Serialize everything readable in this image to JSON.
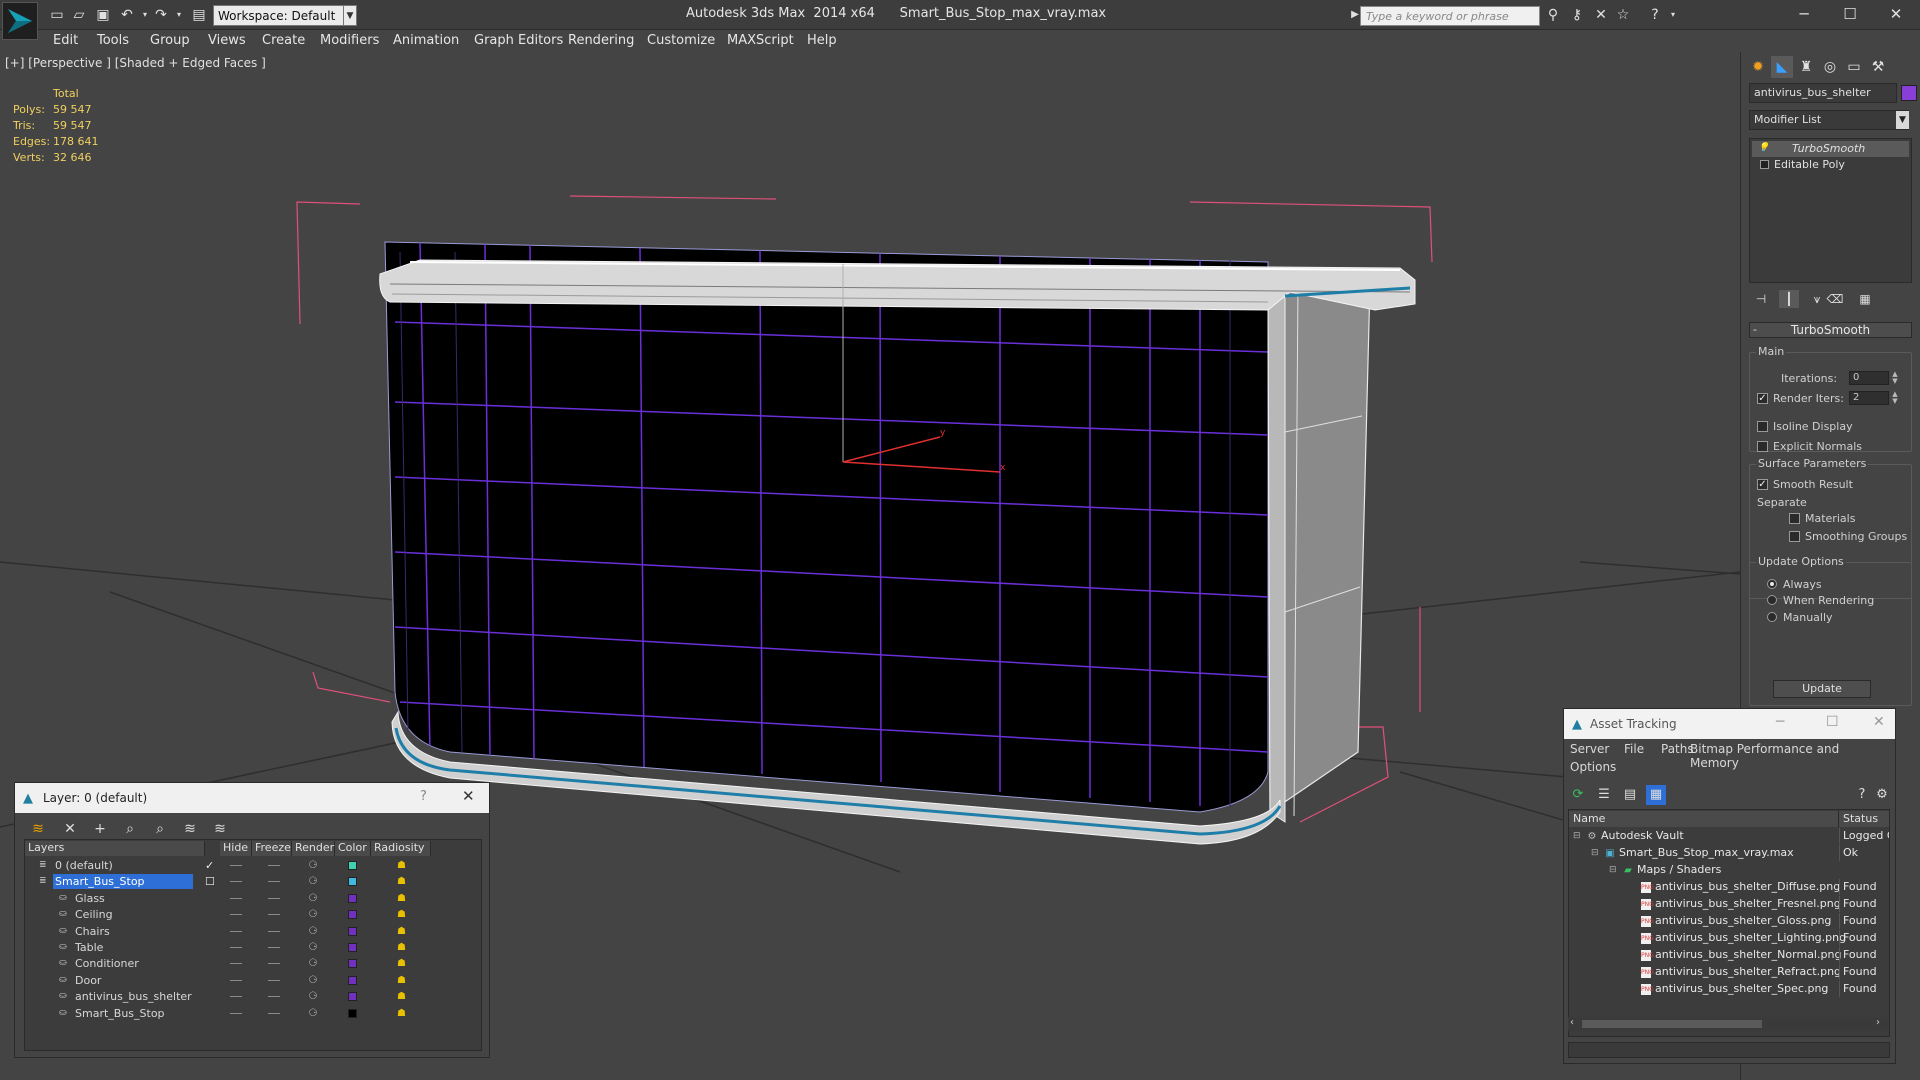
{
  "app": {
    "title": "Autodesk 3ds Max  2014 x64      Smart_Bus_Stop_max_vray.max",
    "workspace": "Workspace: Default",
    "search_placeholder": "Type a keyword or phrase"
  },
  "menu": [
    "Edit",
    "Tools",
    "Group",
    "Views",
    "Create",
    "Modifiers",
    "Animation",
    "Graph Editors",
    "Rendering",
    "Customize",
    "MAXScript",
    "Help"
  ],
  "viewport": {
    "label": "[+] [Perspective ] [Shaded + Edged Faces ]",
    "stats_header": "Total",
    "stats": [
      {
        "label": "Polys:",
        "value": "59 547"
      },
      {
        "label": "Tris:",
        "value": "59 547"
      },
      {
        "label": "Edges:",
        "value": "178 641"
      },
      {
        "label": "Verts:",
        "value": "32 646"
      }
    ]
  },
  "command_panel": {
    "object_name": "antivirus_bus_shelter",
    "object_color": "#8a3ed8",
    "modifier_list": "Modifier List",
    "stack": [
      "TurboSmooth",
      "Editable Poly"
    ],
    "rollout_title": "TurboSmooth",
    "main_group": "Main",
    "iterations_label": "Iterations:",
    "iterations_value": "0",
    "render_iters_label": "Render Iters:",
    "render_iters_value": "2",
    "isoline_display": "Isoline Display",
    "explicit_normals": "Explicit Normals",
    "surface_params": "Surface Parameters",
    "smooth_result": "Smooth Result",
    "separate": "Separate",
    "materials": "Materials",
    "smoothing_groups": "Smoothing Groups",
    "update_options": "Update Options",
    "always": "Always",
    "when_rendering": "When Rendering",
    "manually": "Manually",
    "update_button": "Update"
  },
  "layer_panel": {
    "title": "Layer: 0 (default)",
    "help": "?",
    "columns": [
      "Layers",
      "Hide",
      "Freeze",
      "Render",
      "Color",
      "Radiosity"
    ],
    "rows": [
      {
        "name": "0 (default)",
        "indent": 0,
        "color": "#40d0b0",
        "selected": false,
        "check": true
      },
      {
        "name": "Smart_Bus_Stop",
        "indent": 0,
        "color": "#40b8e0",
        "selected": true,
        "check": false
      },
      {
        "name": "Glass",
        "indent": 1,
        "color": "#7030c0",
        "selected": false,
        "check": false
      },
      {
        "name": "Ceiling",
        "indent": 1,
        "color": "#7030c0",
        "selected": false,
        "check": false
      },
      {
        "name": "Chairs",
        "indent": 1,
        "color": "#7030c0",
        "selected": false,
        "check": false
      },
      {
        "name": "Table",
        "indent": 1,
        "color": "#7030c0",
        "selected": false,
        "check": false
      },
      {
        "name": "Conditioner",
        "indent": 1,
        "color": "#7030c0",
        "selected": false,
        "check": false
      },
      {
        "name": "Door",
        "indent": 1,
        "color": "#7030c0",
        "selected": false,
        "check": false
      },
      {
        "name": "antivirus_bus_shelter",
        "indent": 1,
        "color": "#7030c0",
        "selected": false,
        "check": false
      },
      {
        "name": "Smart_Bus_Stop",
        "indent": 1,
        "color": "#000000",
        "selected": false,
        "check": false
      }
    ]
  },
  "asset_panel": {
    "title": "Asset Tracking",
    "menu": [
      "Server",
      "File",
      "Paths",
      "Bitmap Performance and Memory",
      "Options"
    ],
    "columns": [
      "Name",
      "Status"
    ],
    "rows": [
      {
        "name": "Autodesk Vault",
        "status": "Logged Out",
        "indent": 0,
        "icon": "vault"
      },
      {
        "name": "Smart_Bus_Stop_max_vray.max",
        "status": "Ok",
        "indent": 1,
        "icon": "max"
      },
      {
        "name": "Maps / Shaders",
        "status": "",
        "indent": 2,
        "icon": "folder"
      },
      {
        "name": "antivirus_bus_shelter_Diffuse.png",
        "status": "Found",
        "indent": 3,
        "icon": "png"
      },
      {
        "name": "antivirus_bus_shelter_Fresnel.png",
        "status": "Found",
        "indent": 3,
        "icon": "png"
      },
      {
        "name": "antivirus_bus_shelter_Gloss.png",
        "status": "Found",
        "indent": 3,
        "icon": "png"
      },
      {
        "name": "antivirus_bus_shelter_Lighting.png",
        "status": "Found",
        "indent": 3,
        "icon": "png"
      },
      {
        "name": "antivirus_bus_shelter_Normal.png",
        "status": "Found",
        "indent": 3,
        "icon": "png"
      },
      {
        "name": "antivirus_bus_shelter_Refract.png",
        "status": "Found",
        "indent": 3,
        "icon": "png"
      },
      {
        "name": "antivirus_bus_shelter_Spec.png",
        "status": "Found",
        "indent": 3,
        "icon": "png"
      }
    ]
  }
}
